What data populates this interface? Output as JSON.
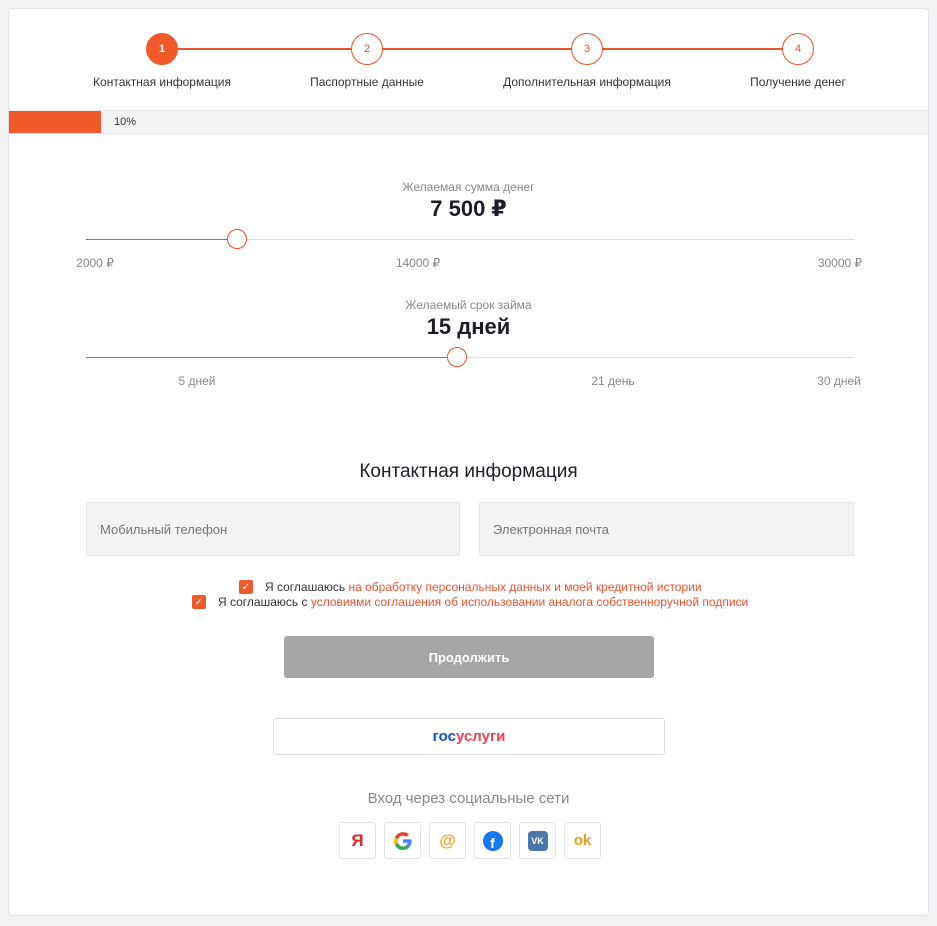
{
  "stepper": {
    "steps": [
      {
        "number": "1",
        "label": "Контактная информация",
        "active": true
      },
      {
        "number": "2",
        "label": "Паспортные данные",
        "active": false
      },
      {
        "number": "3",
        "label": "Дополнительная информация",
        "active": false
      },
      {
        "number": "4",
        "label": "Получение денег",
        "active": false
      }
    ]
  },
  "progress": {
    "value": 0.1,
    "label": "10%"
  },
  "amount_slider": {
    "caption": "Желаемая сумма денег",
    "value_label": "7 500 ₽",
    "value": 7500,
    "min": 2000,
    "max": 30000,
    "ticks": [
      "2000 ₽",
      "14000 ₽",
      "30000 ₽"
    ]
  },
  "term_slider": {
    "caption": "Желаемый срок займа",
    "value_label": "15 дней",
    "value": 15,
    "min": 1,
    "max": 30,
    "ticks": [
      "5 дней",
      "21 день",
      "30 дней"
    ]
  },
  "contact": {
    "title": "Контактная информация",
    "phone_placeholder": "Мобильный телефон",
    "email_placeholder": "Электронная почта"
  },
  "agreements": [
    {
      "prefix": "Я соглашаюсь ",
      "link": "на обработку персональных данных и моей кредитной истории",
      "checked": true
    },
    {
      "prefix": "Я соглашаюсь с ",
      "link": "условиями соглашения об использовании аналога собственноручной подписи",
      "checked": true
    }
  ],
  "continue_label": "Продолжить",
  "gosuslugi": {
    "part_a": "гос",
    "part_b": "услуги"
  },
  "social": {
    "title": "Вход через социальные сети",
    "buttons": [
      {
        "icon": "yandex-icon",
        "glyph": "Я",
        "color": "#e8222a"
      },
      {
        "icon": "google-icon",
        "glyph": "G",
        "color": "#4285f4"
      },
      {
        "icon": "mailru-icon",
        "glyph": "@",
        "color": "#f5a623"
      },
      {
        "icon": "facebook-icon",
        "glyph": "f",
        "color": "#1877f2"
      },
      {
        "icon": "vk-icon",
        "glyph": "VK",
        "color": "#4a76a8"
      },
      {
        "icon": "odnoklassniki-icon",
        "glyph": "ok",
        "color": "#f49a1a"
      }
    ]
  },
  "colors": {
    "accent": "#f05a2a",
    "button_disabled": "#a6a6a8"
  }
}
